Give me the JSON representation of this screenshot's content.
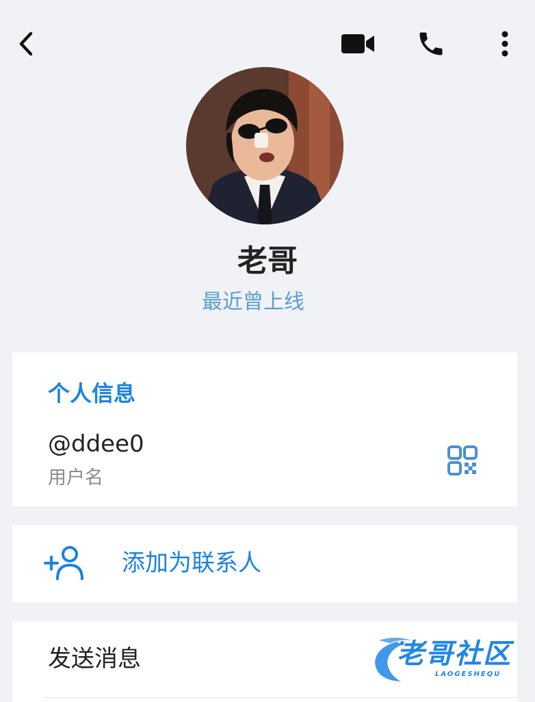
{
  "colors": {
    "background": "#f1f2f6",
    "accent": "#1a82e2",
    "status": "#5a9dd8",
    "primary_text": "#222222",
    "secondary_text": "#8a8a8a"
  },
  "topbar": {
    "back_icon": "chevron-left-icon",
    "video_icon": "video-camera-icon",
    "call_icon": "phone-icon",
    "more_icon": "more-vertical-icon"
  },
  "profile": {
    "avatar": "avatar-photo",
    "name": "老哥",
    "status": "最近曾上线"
  },
  "info": {
    "title": "个人信息",
    "username": "@ddee0",
    "username_label": "用户名",
    "qr_icon": "qr-code-icon"
  },
  "actions": {
    "add_contact_icon": "add-person-icon",
    "add_contact": "添加为联系人",
    "send_message": "发送消息"
  },
  "watermark": {
    "text": "老哥社区",
    "sub": "LAOGESHEQU"
  }
}
